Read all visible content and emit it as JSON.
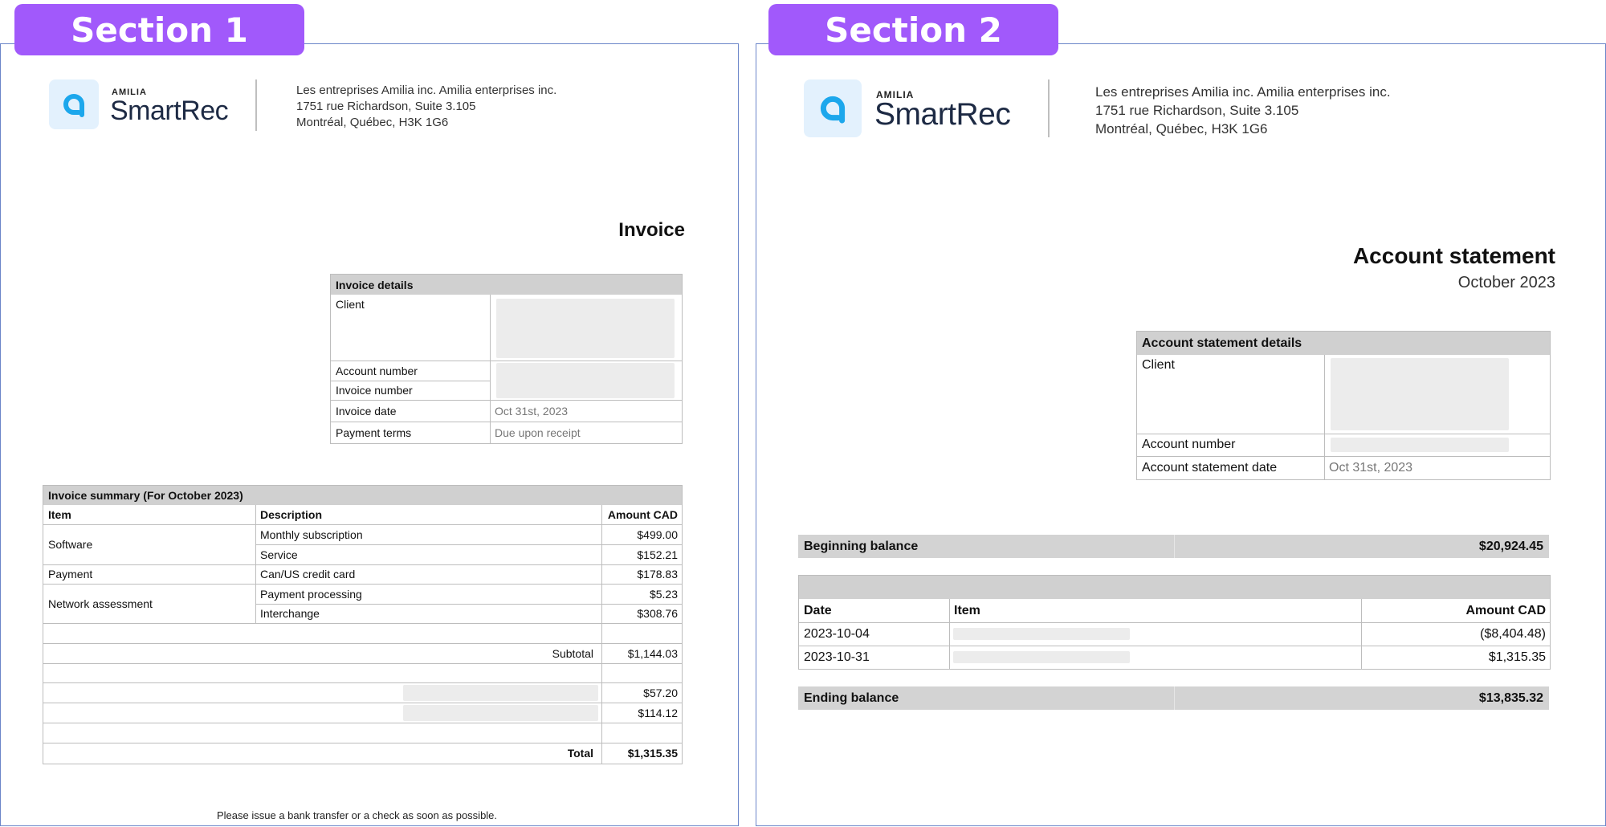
{
  "sections": [
    {
      "label": "Section 1"
    },
    {
      "label": "Section 2"
    }
  ],
  "brand": {
    "small": "AMILIA",
    "name": "SmartRec",
    "accent_color": "#1ca7ec",
    "tab_color": "#a159fb",
    "address": [
      "Les entreprises Amilia inc. Amilia enterprises inc.",
      "1751 rue Richardson, Suite 3.105",
      "Montréal, Québec, H3K 1G6"
    ]
  },
  "invoice": {
    "title": "Invoice",
    "details": {
      "header": "Invoice details",
      "client_label": "Client",
      "account_number_label": "Account number",
      "invoice_number_label": "Invoice number",
      "invoice_date_label": "Invoice date",
      "invoice_date": "Oct 31st, 2023",
      "payment_terms_label": "Payment terms",
      "payment_terms": "Due upon receipt"
    },
    "summary": {
      "header": "Invoice summary (For October 2023)",
      "columns": [
        "Item",
        "Description",
        "Amount CAD"
      ],
      "rows": [
        {
          "item": "Software",
          "description": "Monthly subscription",
          "amount": "$499.00"
        },
        {
          "item": "",
          "description": "Service",
          "amount": "$152.21"
        },
        {
          "item": "Payment",
          "description": "Can/US credit card",
          "amount": "$178.83"
        },
        {
          "item": "Network assessment",
          "description": "Payment processing",
          "amount": "$5.23"
        },
        {
          "item": "",
          "description": "Interchange",
          "amount": "$308.76"
        }
      ],
      "subtotal_label": "Subtotal",
      "subtotal": "$1,144.03",
      "tax_1": "$57.20",
      "tax_2": "$114.12",
      "total_label": "Total",
      "total": "$1,315.35"
    },
    "footer": "Please issue a bank transfer or a check as soon as possible."
  },
  "statement": {
    "title": "Account statement",
    "period": "October 2023",
    "details": {
      "header": "Account statement details",
      "client_label": "Client",
      "account_number_label": "Account number",
      "date_label": "Account statement date",
      "date": "Oct 31st, 2023"
    },
    "beginning_label": "Beginning balance",
    "beginning_amount": "$20,924.45",
    "columns": [
      "Date",
      "Item",
      "Amount CAD"
    ],
    "rows": [
      {
        "date": "2023-10-04",
        "amount": "($8,404.48)"
      },
      {
        "date": "2023-10-31",
        "amount": "$1,315.35"
      }
    ],
    "ending_label": "Ending balance",
    "ending_amount": "$13,835.32"
  }
}
